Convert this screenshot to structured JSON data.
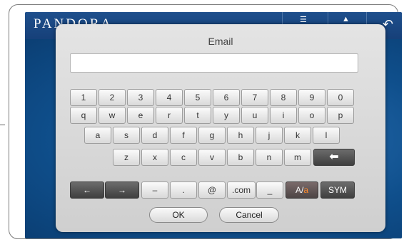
{
  "app": {
    "logo": "PANDORA"
  },
  "dialog": {
    "title": "Email",
    "email_value": "",
    "rows": [
      [
        "1",
        "2",
        "3",
        "4",
        "5",
        "6",
        "7",
        "8",
        "9",
        "0"
      ],
      [
        "q",
        "w",
        "e",
        "r",
        "t",
        "y",
        "u",
        "i",
        "o",
        "p"
      ],
      [
        "a",
        "s",
        "d",
        "f",
        "g",
        "h",
        "j",
        "k",
        "l"
      ],
      [
        "z",
        "x",
        "c",
        "v",
        "b",
        "n",
        "m"
      ]
    ],
    "special": {
      "backspace": "backspace",
      "left": "←",
      "right": "→",
      "dash": "–",
      "dot": ".",
      "at": "@",
      "dotcom": ".com",
      "underscore": "_",
      "case_a": "A/",
      "case_b": "a",
      "sym": "SYM"
    },
    "ok_label": "OK",
    "cancel_label": "Cancel"
  },
  "colors": {
    "accent": "#ff8a2a",
    "screen_bg": "#0b4f8b"
  }
}
